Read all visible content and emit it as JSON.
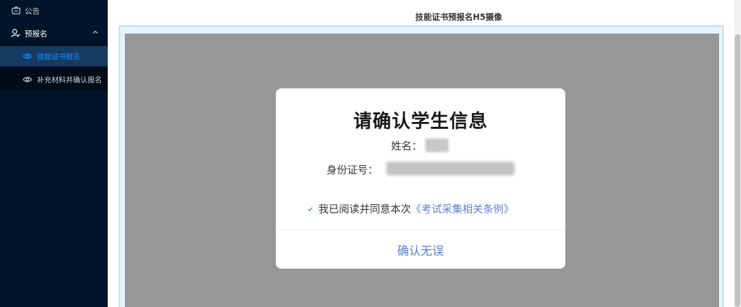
{
  "sidebar": {
    "items": [
      {
        "label": "公告",
        "icon": "notice-icon"
      },
      {
        "label": "预报名",
        "icon": "user-edit-icon",
        "expanded": true
      }
    ],
    "submenu": [
      {
        "label": "技能证书报名",
        "icon": "eye-icon",
        "selected": true
      },
      {
        "label": "补充材料并确认报名",
        "icon": "eye-icon",
        "selected": false
      }
    ]
  },
  "main": {
    "title": "技能证书预报名H5摄像"
  },
  "dialog": {
    "title": "请确认学生信息",
    "name_label": "姓名：",
    "id_label": "身份证号：",
    "agree_text": "我已阅读并同意本次",
    "agree_link": "《考试采集相关条例》",
    "agree_checked": true,
    "confirm_label": "确认无误"
  },
  "colors": {
    "sidebar_bg": "#001529",
    "selected_bg": "#163b63",
    "accent": "#1890ff",
    "link": "#5b7fd6",
    "overlay": "#979797"
  }
}
